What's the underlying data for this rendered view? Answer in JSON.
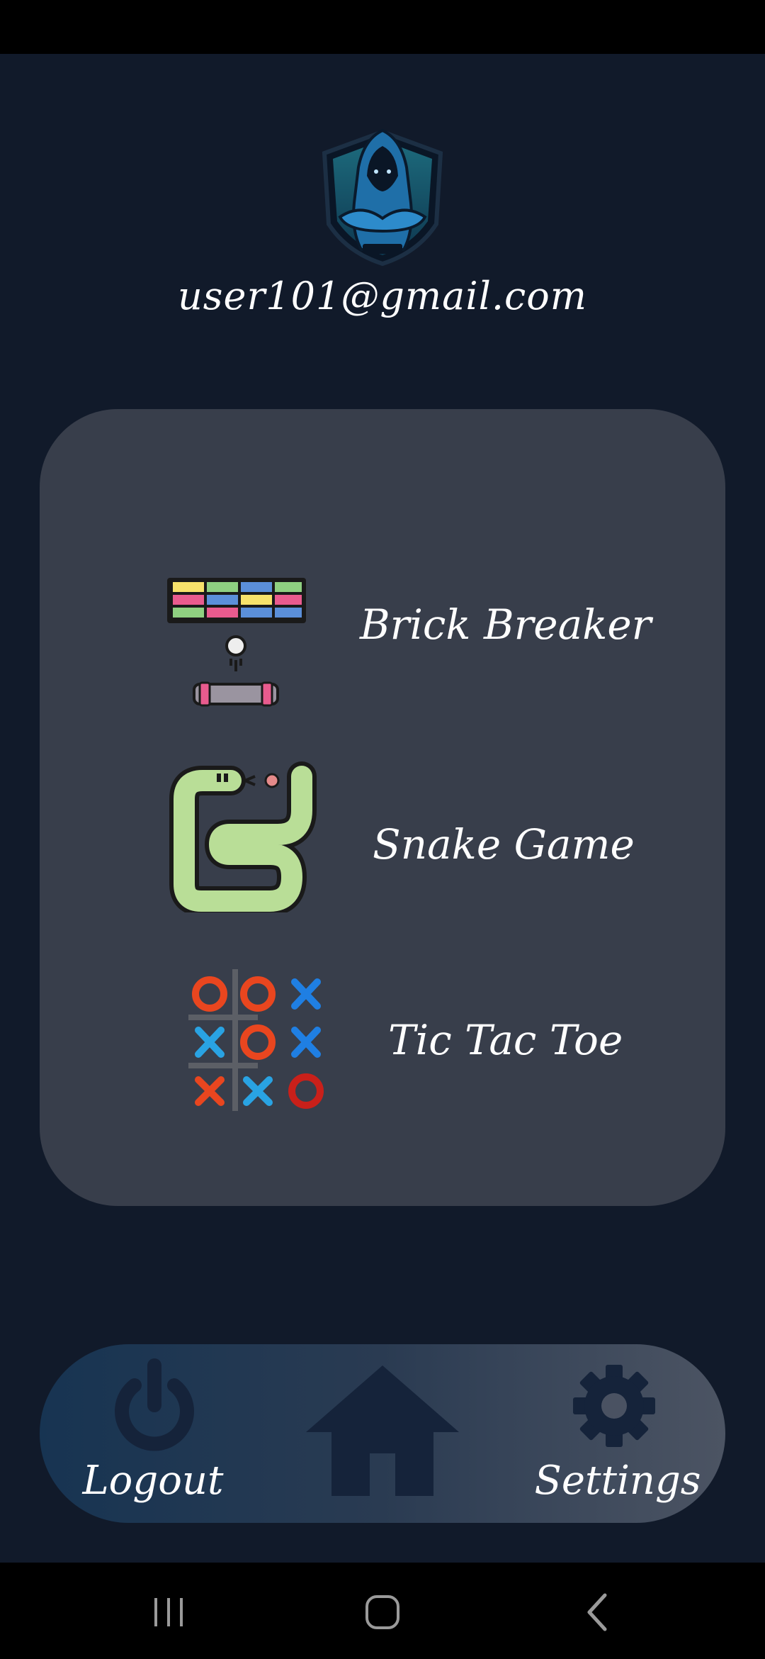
{
  "user": {
    "email": "user101@gmail.com"
  },
  "games": [
    {
      "label": "Brick Breaker",
      "icon": "brick-breaker-icon"
    },
    {
      "label": "Snake Game",
      "icon": "snake-icon"
    },
    {
      "label": "Tic Tac Toe",
      "icon": "tic-tac-toe-icon"
    }
  ],
  "nav": {
    "logout_label": "Logout",
    "settings_label": "Settings",
    "home_icon": "home-icon"
  },
  "colors": {
    "background": "#111a2a",
    "card": "#383e4b",
    "nav_gradient_start": "#173452",
    "nav_gradient_end": "#4c5463",
    "icon_dark": "#15233a"
  }
}
